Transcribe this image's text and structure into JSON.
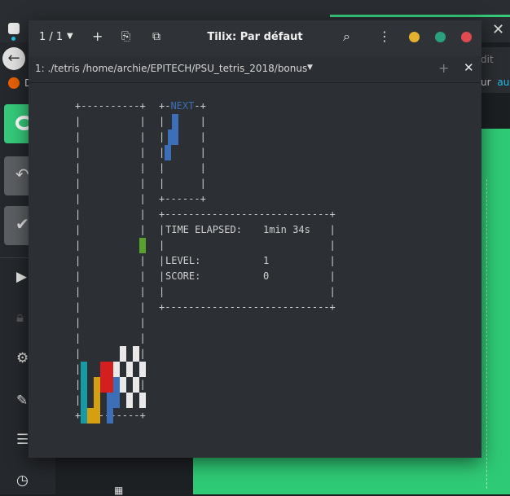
{
  "background": {
    "tab_partial": "D",
    "edit_partial": "dit",
    "tab2_partial": "ur",
    "tab2_icon": "au"
  },
  "window": {
    "session": "1 / 1",
    "title": "Tilix: Par défaut"
  },
  "terminal": {
    "tab_title": "1: ./tetris /home/archie/EPITECH/PSU_tetris_2018/bonus",
    "next_label": "NEXT",
    "stats": {
      "time_label": "TIME ELAPSED:",
      "time_value": "1min 34s",
      "level_label": "LEVEL:",
      "level_value": "1",
      "score_label": "SCORE:",
      "score_value": "0"
    }
  },
  "colors": {
    "next_piece": "#3d6fb8",
    "falling_piece": "#5aa02c",
    "teal": "#169aa6",
    "yellow": "#d4a012",
    "red": "#d31f1f",
    "blue": "#3d6fb8",
    "checker_light": "#e9e9e9",
    "checker_dark": "#1a1a1a",
    "dot_yellow": "#e5b22f",
    "dot_green": "#2aa17e",
    "dot_red": "#e24a4f"
  }
}
